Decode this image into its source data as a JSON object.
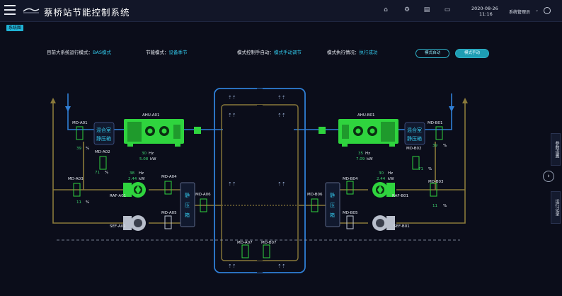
{
  "header": {
    "title": "蔡桥站节能控制系统",
    "date": "2020-08-26",
    "time": "11:16",
    "user": "系统管理员",
    "icons": [
      "home-icon",
      "gear-icon",
      "document-icon",
      "monitor-icon",
      "power-icon"
    ]
  },
  "tab": {
    "label": "系统图"
  },
  "status": {
    "run_mode_label": "目前大系统运行模式：",
    "run_mode_value": "BAS模式",
    "save_mode_label": "节能模式：",
    "save_mode_value": "设备季节",
    "control_label": "模式控制手自动：",
    "control_value": "模式手动调节",
    "exec_label": "模式执行情况：",
    "exec_value": "执行成功"
  },
  "buttons": {
    "auto": "模式自动",
    "manual": "模式手动"
  },
  "side_tabs": {
    "params": "参数设置",
    "alarm": "运行记录"
  },
  "left": {
    "md_a01": {
      "label": "MD-A01",
      "value": "39",
      "unit": "%"
    },
    "md_a02": {
      "label": "MD-A02",
      "value": "71",
      "unit": "%"
    },
    "md_a03": {
      "label": "MD-A03",
      "value": "11",
      "unit": "%"
    },
    "md_a04": {
      "label": "MD-A04"
    },
    "md_a05": {
      "label": "MD-A05"
    },
    "md_a06": {
      "label": "MD-A06"
    },
    "md_a07": {
      "label": "MD-A07"
    },
    "ahu": {
      "label": "AHU-A01",
      "hz": "30",
      "hz_unit": "Hz",
      "kw": "5.08",
      "kw_unit": "kW"
    },
    "raf": {
      "label": "RAF-A01",
      "hz": "38",
      "hz_unit": "Hz",
      "kw": "2.44",
      "kw_unit": "kW"
    },
    "sef": {
      "label": "SEF-A01"
    },
    "mix_box": [
      "混合室",
      "静压箱"
    ],
    "static_box": [
      "静",
      "压",
      "箱"
    ]
  },
  "right": {
    "md_b01": {
      "label": "MD-B01",
      "value": "39",
      "unit": "%"
    },
    "md_b02": {
      "label": "MD-B02",
      "value": "71",
      "unit": "%"
    },
    "md_b03": {
      "label": "MD-B03",
      "value": "11",
      "unit": "%"
    },
    "md_b04": {
      "label": "MD-B04"
    },
    "md_b05": {
      "label": "MD-B05"
    },
    "md_b06": {
      "label": "MD-B06"
    },
    "md_b07": {
      "label": "MD-B07"
    },
    "ahu": {
      "label": "AHU-B01",
      "hz": "35",
      "hz_unit": "Hz",
      "kw": "7.09",
      "kw_unit": "kW"
    },
    "raf": {
      "label": "RAF-B01",
      "hz": "30",
      "hz_unit": "Hz",
      "kw": "2.44",
      "kw_unit": "kW"
    },
    "sef": {
      "label": "SEF-B01"
    },
    "mix_box": [
      "混合室",
      "静压箱"
    ],
    "static_box": [
      "静",
      "压",
      "箱"
    ]
  },
  "colors": {
    "duct_yellow": "#8a7a3a",
    "duct_blue": "#2f7fd6",
    "equip_green": "#34e04a",
    "accent": "#32c8ea"
  }
}
